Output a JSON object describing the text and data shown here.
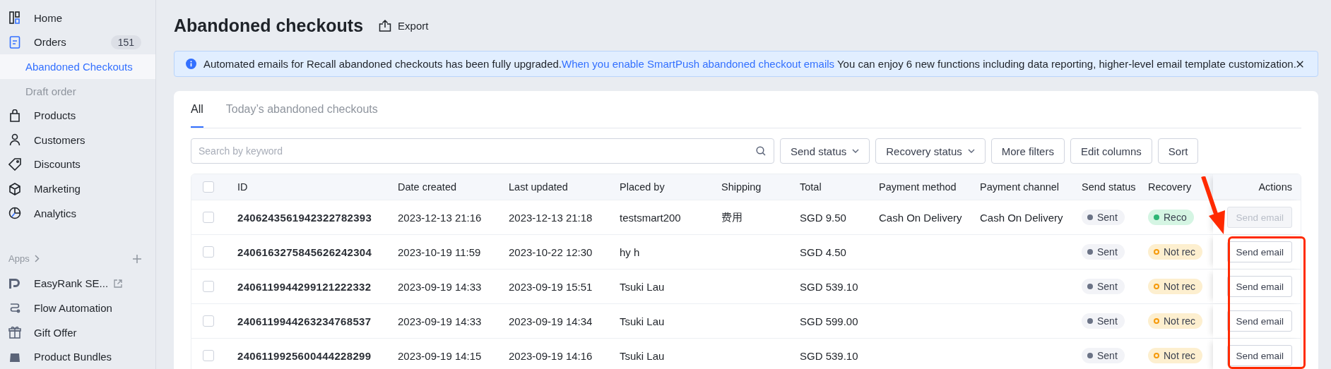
{
  "sidebar": {
    "items": [
      {
        "label": "Home",
        "kind": "main",
        "selected": false
      },
      {
        "label": "Orders",
        "kind": "main",
        "badge": "151",
        "selected": false
      },
      {
        "label": "Abandoned Checkouts",
        "kind": "sub",
        "selected": true
      },
      {
        "label": "Draft order",
        "kind": "sub",
        "selected": false
      },
      {
        "label": "Products",
        "kind": "main",
        "selected": false
      },
      {
        "label": "Customers",
        "kind": "main",
        "selected": false
      },
      {
        "label": "Discounts",
        "kind": "main",
        "selected": false
      },
      {
        "label": "Marketing",
        "kind": "main",
        "selected": false
      },
      {
        "label": "Analytics",
        "kind": "main",
        "selected": false
      }
    ],
    "apps": {
      "title": "Apps",
      "items": [
        {
          "label": "EasyRank SE...",
          "external": true
        },
        {
          "label": "Flow Automation",
          "external": false
        },
        {
          "label": "Gift Offer",
          "external": false
        },
        {
          "label": "Product Bundles",
          "external": false
        }
      ]
    }
  },
  "page": {
    "title": "Abandoned checkouts",
    "export": "Export"
  },
  "banner": {
    "text": "Automated emails for Recall abandoned checkouts has been fully upgraded.",
    "link": "When you enable SmartPush abandoned checkout emails",
    "rest": "You can enjoy 6 new functions including data reporting, higher-level email template customization."
  },
  "tabs": [
    {
      "label": "All",
      "selected": true
    },
    {
      "label": "Today’s abandoned checkouts",
      "selected": false
    }
  ],
  "search": {
    "placeholder": "Search by keyword"
  },
  "filters": [
    {
      "label": "Send status",
      "dropdown": true
    },
    {
      "label": "Recovery status",
      "dropdown": true
    },
    {
      "label": "More filters",
      "dropdown": false
    },
    {
      "label": "Edit columns",
      "dropdown": false
    },
    {
      "label": "Sort",
      "dropdown": false
    }
  ],
  "table": {
    "columns": [
      "ID",
      "Date created",
      "Last updated",
      "Placed by",
      "Shipping",
      "Total",
      "Payment method",
      "Payment channel",
      "Send status",
      "Recovery",
      "Actions"
    ],
    "select_all": {
      "checked": false
    },
    "rows": [
      {
        "checked": false,
        "id": "2406243561942322782393",
        "date_created": "2023-12-13 21:16",
        "last_updated": "2023-12-13 21:18",
        "placed_by": "testsmart200",
        "shipping": "费用",
        "total": "SGD 9.50",
        "payment_method": "Cash On Delivery",
        "payment_channel": "Cash On Delivery",
        "send_status": "Sent",
        "recovery": {
          "label": "Reco",
          "kind": "recovered"
        },
        "action": {
          "label": "Send email",
          "disabled": true
        }
      },
      {
        "checked": false,
        "id": "2406163275845626242304",
        "date_created": "2023-10-19 11:59",
        "last_updated": "2023-10-22 12:30",
        "placed_by": "hy h",
        "total": "SGD 4.50",
        "send_status": "Sent",
        "recovery": {
          "label": "Not rec",
          "kind": "not_recovered"
        },
        "action": {
          "label": "Send email",
          "disabled": false
        }
      },
      {
        "checked": false,
        "id": "2406119944299121222332",
        "date_created": "2023-09-19 14:33",
        "last_updated": "2023-09-19 15:51",
        "placed_by": "Tsuki Lau",
        "total": "SGD 539.10",
        "send_status": "Sent",
        "recovery": {
          "label": "Not rec",
          "kind": "not_recovered"
        },
        "action": {
          "label": "Send email",
          "disabled": false
        }
      },
      {
        "checked": false,
        "id": "2406119944263234768537",
        "date_created": "2023-09-19 14:33",
        "last_updated": "2023-09-19 14:34",
        "placed_by": "Tsuki Lau",
        "total": "SGD 599.00",
        "send_status": "Sent",
        "recovery": {
          "label": "Not rec",
          "kind": "not_recovered"
        },
        "action": {
          "label": "Send email",
          "disabled": false
        }
      },
      {
        "checked": false,
        "id": "2406119925600444228299",
        "date_created": "2023-09-19 14:15",
        "last_updated": "2023-09-19 14:16",
        "placed_by": "Tsuki Lau",
        "total": "SGD 539.10",
        "send_status": "Sent",
        "recovery": {
          "label": "Not rec",
          "kind": "not_recovered"
        },
        "action": {
          "label": "Send email",
          "disabled": false
        }
      }
    ]
  }
}
